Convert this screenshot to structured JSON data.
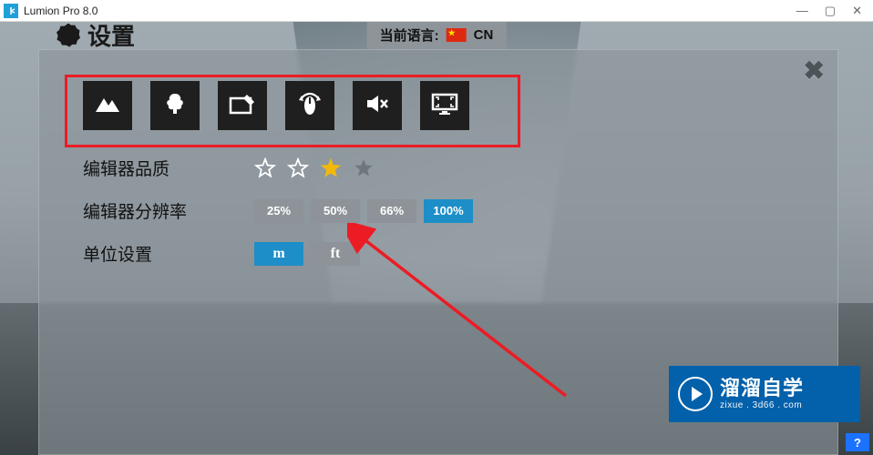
{
  "window": {
    "title": "Lumion Pro 8.0",
    "min": "—",
    "max": "▢",
    "close": "✕"
  },
  "header": {
    "settings_label": "设置",
    "lang_prefix": "当前语言:",
    "lang_code": "CN"
  },
  "toolbar": {
    "icons": [
      "mountain-icon",
      "tree-icon",
      "tablet-edit-icon",
      "mouse-rotate-icon",
      "mute-icon",
      "monitor-icon"
    ]
  },
  "settings": {
    "quality": {
      "label": "编辑器品质",
      "value": 3,
      "max": 4
    },
    "resolution": {
      "label": "编辑器分辨率",
      "options": [
        "25%",
        "50%",
        "66%",
        "100%"
      ],
      "selected": "100%"
    },
    "units": {
      "label": "单位设置",
      "options": [
        "m",
        "ft"
      ],
      "selected": "m"
    }
  },
  "watermark": {
    "main": "溜溜自学",
    "sub": "zixue . 3d66 . com"
  },
  "help": {
    "label": "?"
  }
}
